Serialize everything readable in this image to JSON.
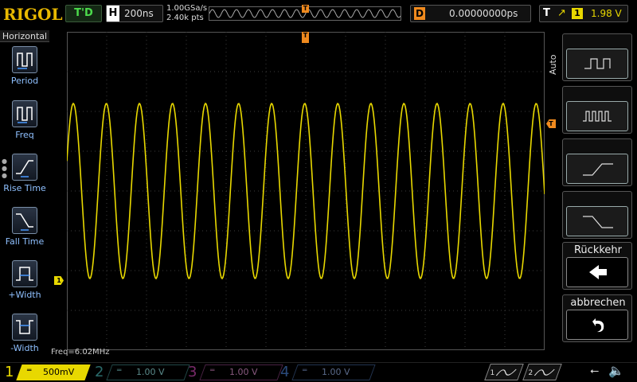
{
  "top": {
    "logo": "RIGOL",
    "trigger_status": "T'D",
    "horizontal_label": "H",
    "timebase": "200ns",
    "sample_rate": "1.00GSa/s",
    "memory_depth": "2.40k pts",
    "delay_label": "D",
    "delay_value": "0.00000000ps",
    "trigger_label": "T",
    "trigger_edge_icon": "rising-edge-icon",
    "trigger_source": "1",
    "trigger_level": "1.98 V"
  },
  "left_menu": {
    "title": "Horizontal",
    "items": [
      {
        "label": "Period",
        "icon": "period-icon"
      },
      {
        "label": "Freq",
        "icon": "frequency-icon"
      },
      {
        "label": "Rise Time",
        "icon": "rise-time-icon"
      },
      {
        "label": "Fall Time",
        "icon": "fall-time-icon"
      },
      {
        "label": "+Width",
        "icon": "positive-width-icon"
      },
      {
        "label": "-Width",
        "icon": "negative-width-icon"
      }
    ]
  },
  "markers": {
    "trigger_position": "T",
    "trigger_level": "T",
    "ch1_ground": "1"
  },
  "measurement": {
    "freq_readout": "Freq=6.02MHz"
  },
  "right_panel": {
    "auto_label": "Auto",
    "buttons": [
      {
        "name": "wide-pulse",
        "icon": "wide-pulse-icon"
      },
      {
        "name": "narrow-pulse",
        "icon": "pulse-train-icon"
      },
      {
        "name": "rising-edge",
        "icon": "rising-edge-icon"
      },
      {
        "name": "falling-edge",
        "icon": "falling-edge-icon"
      }
    ],
    "back_label": "Rückkehr",
    "back_icon": "arrow-left-icon",
    "cancel_label": "abbrechen",
    "cancel_icon": "undo-icon"
  },
  "channels": [
    {
      "num": "1",
      "value": "500mV",
      "color": "#e8d800"
    },
    {
      "num": "2",
      "value": "1.00 V",
      "color": "#2a6a6a"
    },
    {
      "num": "3",
      "value": "1.00 V",
      "color": "#7a2a6a"
    },
    {
      "num": "4",
      "value": "1.00 V",
      "color": "#2a4a7a"
    }
  ],
  "bottom_right": {
    "math1": "1",
    "math2": "2",
    "usb_icon": "usb-icon",
    "speaker_icon": "speaker-muted-icon"
  },
  "colors": {
    "ch1": "#e8d800",
    "trigger": "#f08a1e",
    "menu_text": "#8fc0ff",
    "trace_status": "#4cdc4c"
  },
  "waveform": {
    "cycles_on_screen": 14.45,
    "amplitude_divisions": 2.2,
    "offset_divisions": 0.0
  }
}
